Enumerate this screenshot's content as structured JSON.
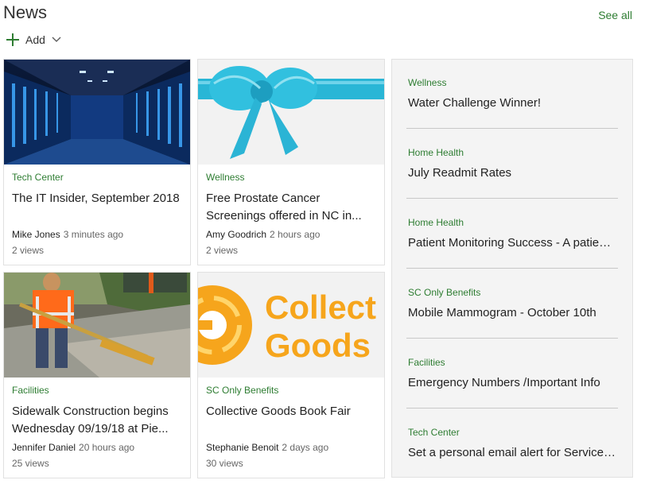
{
  "header": {
    "title": "News",
    "see_all": "See all",
    "add_label": "Add",
    "add_icon": "plus-icon",
    "add_menu_icon": "chevron-down-icon"
  },
  "colors": {
    "accent": "#2e7d32",
    "side_bg": "#f4f4f4",
    "border": "#e1e1e1"
  },
  "cards": [
    {
      "image": "server-room-image",
      "category": "Tech Center",
      "title": "The IT Insider, September 2018",
      "author": "Mike Jones",
      "time": "3 minutes ago",
      "views": "2 views"
    },
    {
      "image": "blue-ribbon-bow-image",
      "category": "Wellness",
      "title": "Free Prostate Cancer Screenings offered in NC in...",
      "author": "Amy Goodrich",
      "time": "2 hours ago",
      "views": "2 views"
    },
    {
      "image": "construction-worker-image",
      "category": "Facilities",
      "title": "Sidewalk Construction begins Wednesday 09/19/18 at Pie...",
      "author": "Jennifer Daniel",
      "time": "20 hours ago",
      "views": "25 views"
    },
    {
      "image": "collective-goods-logo-image",
      "category": "SC Only Benefits",
      "title": "Collective Goods Book Fair",
      "author": "Stephanie Benoit",
      "time": "2 days ago",
      "views": "30 views",
      "logo_text_1": "Collect",
      "logo_text_2": "Goods"
    }
  ],
  "side_items": [
    {
      "category": "Wellness",
      "title": "Water Challenge Winner!"
    },
    {
      "category": "Home Health",
      "title": "July Readmit Rates"
    },
    {
      "category": "Home Health",
      "title": "Patient Monitoring Success - A patient story"
    },
    {
      "category": "SC Only Benefits",
      "title": "Mobile Mammogram - October 10th"
    },
    {
      "category": "Facilities",
      "title": "Emergency Numbers /Important Info"
    },
    {
      "category": "Tech Center",
      "title": "Set a personal email alert for Service Desk"
    }
  ]
}
